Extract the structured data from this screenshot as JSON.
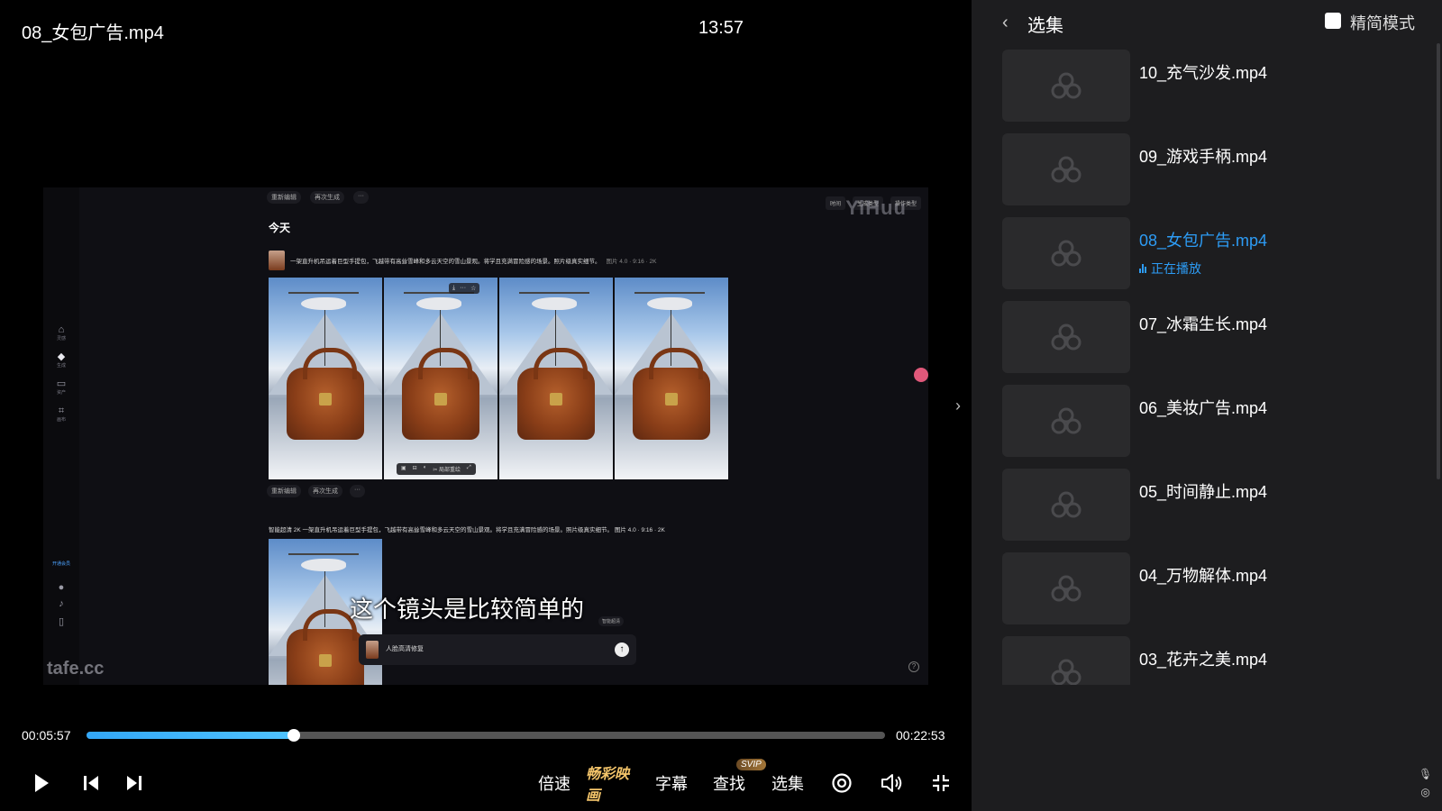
{
  "player": {
    "file_title": "08_女包广告.mp4",
    "clock": "13:57",
    "subtitle": "这个镜头是比较简单的",
    "time_current": "00:05:57",
    "time_total": "00:22:53",
    "progress": 0.26,
    "controls": {
      "speed": "倍速",
      "color": "畅彩映画",
      "subtitles": "字幕",
      "search": "查找",
      "search_badge": "SVIP",
      "episodes": "选集"
    },
    "icons": [
      "play-icon",
      "previous-icon",
      "next-icon",
      "loop-icon",
      "volume-icon",
      "exit-fullscreen-icon"
    ]
  },
  "video_content": {
    "today": "今天",
    "toolbar": [
      "重新编辑",
      "再次生成",
      "···"
    ],
    "filters": [
      "时间",
      "生成类型",
      "操作类型"
    ],
    "watermark": "YiHuu",
    "prompt": "一架直升机吊运着巨型手提包，飞越带有高耸雪峰和多云天空的雪山景观。将学且充满冒险感的场景。照片级真实细节。",
    "prompt_meta": "图片 4.0 · 9:16 · 2K",
    "prompt2": "智能超清 2K  一架直升机吊运着巨型手提包，飞越带有高耸雪峰和多云天空的雪山景观。将学且充满冒险感的场景。照片级真实细节。 图片 4.0 · 9:16 · 2K",
    "actions": [
      "重新编辑",
      "再次生成",
      "···"
    ],
    "image_tools": [
      "⤓",
      "···",
      "☆"
    ],
    "bottom_tools": [
      "▣",
      "⊟",
      "◐",
      "✂ 局部重绘",
      "⤢"
    ],
    "sidebar_items": [
      "灵感",
      "生成",
      "资产",
      "画布"
    ],
    "vip_label": "开通会员",
    "composer_text": "人脸高清修复",
    "composer_tag": "智能超清",
    "logo_text": "tafe.cc"
  },
  "panel": {
    "title": "选集",
    "simple_mode_label": "精简模式",
    "now_playing_label": "正在播放",
    "episodes": [
      {
        "name": "10_充气沙发.mp4",
        "active": false
      },
      {
        "name": "09_游戏手柄.mp4",
        "active": false
      },
      {
        "name": "08_女包广告.mp4",
        "active": true
      },
      {
        "name": "07_冰霜生长.mp4",
        "active": false
      },
      {
        "name": "06_美妆广告.mp4",
        "active": false
      },
      {
        "name": "05_时间静止.mp4",
        "active": false
      },
      {
        "name": "04_万物解体.mp4",
        "active": false
      },
      {
        "name": "03_花卉之美.mp4",
        "active": false
      }
    ]
  },
  "colors": {
    "accent": "#2d9cf5",
    "panel_bg": "#1d1d1f",
    "special": "#f3c46a"
  }
}
